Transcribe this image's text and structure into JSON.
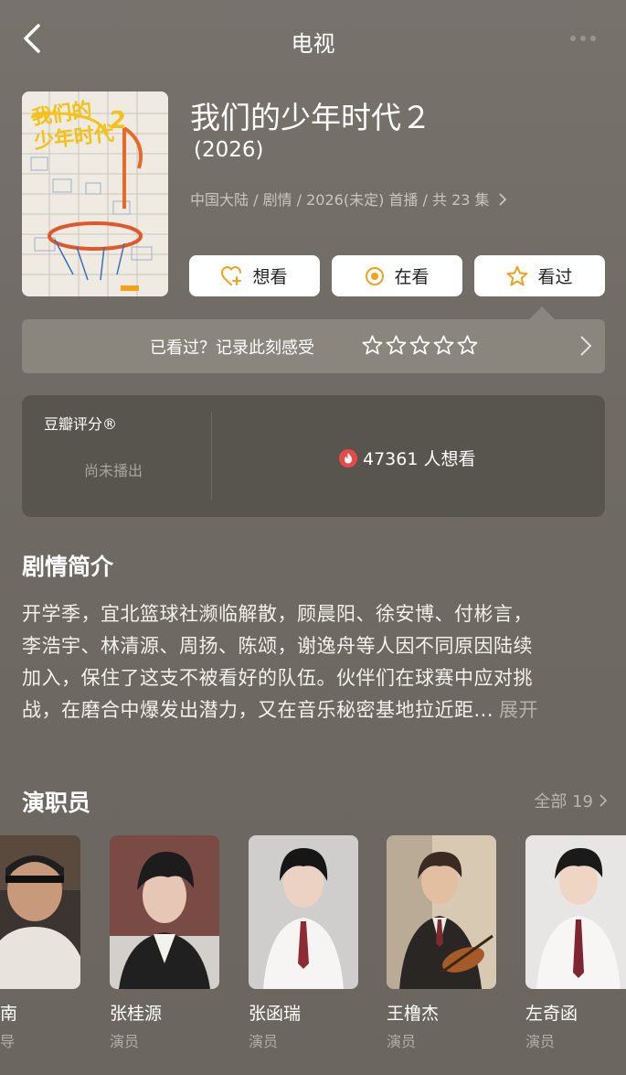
{
  "navbar": {
    "title": "电视"
  },
  "header": {
    "poster_text_line1": "我们的",
    "poster_text_line2": "少年时代",
    "poster_badge": "2",
    "title": "我们的少年时代２",
    "year": "(2026)",
    "meta": "中国大陆 / 剧情 / 2026(未定) 首播 / 共 23 集"
  },
  "actions": [
    {
      "label": "想看",
      "icon": "heart-plus-icon"
    },
    {
      "label": "在看",
      "icon": "radio-dot-icon"
    },
    {
      "label": "看过",
      "icon": "star-icon"
    }
  ],
  "record": {
    "text": "已看过？记录此刻感受",
    "stars": 5
  },
  "rating": {
    "label": "豆瓣评分®",
    "status": "尚未播出",
    "wish": "47361 人想看"
  },
  "synopsis": {
    "title": "剧情简介",
    "lines": [
      "开学季，宜北篮球社濒临解散，顾晨阳、徐安博、付彬言，",
      "李浩宇、林清源、周扬、陈颂，谢逸舟等人因不同原因陆续",
      "加入，保住了这支不被看好的队伍。伙伴们在球赛中应对挑",
      "战，在磨合中爆发出潜力，又在音乐秘密基地拉近距..."
    ],
    "expand": "展开"
  },
  "cast": {
    "title": "演职员",
    "all": "全部 19",
    "members": [
      {
        "name": "南",
        "role": "导"
      },
      {
        "name": "张桂源",
        "role": "演员"
      },
      {
        "name": "张函瑞",
        "role": "演员"
      },
      {
        "name": "王橹杰",
        "role": "演员"
      },
      {
        "name": "左奇函",
        "role": "演员"
      }
    ]
  },
  "colors": {
    "background": "#6f6a63",
    "card": "#58544e",
    "record_bar": "#8a857d",
    "accent_orange": "#f0a21a",
    "flame_red": "#e84a4a"
  }
}
